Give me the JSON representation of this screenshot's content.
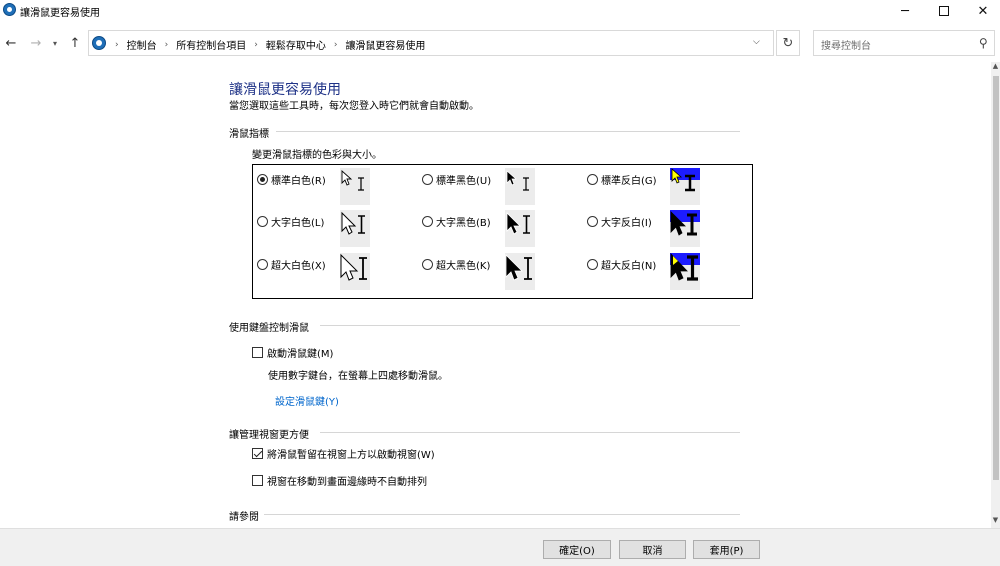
{
  "window": {
    "title": "讓滑鼠更容易使用",
    "minimize_glyph": "─",
    "close_glyph": "✕"
  },
  "nav": {
    "back_glyph": "←",
    "forward_glyph": "→",
    "recent_glyph": "▾",
    "up_glyph": "↑",
    "breadcrumbs": [
      "控制台",
      "所有控制台項目",
      "輕鬆存取中心",
      "讓滑鼠更容易使用"
    ],
    "breadcrumb_sep": "›",
    "dropdown_glyph": "⌵",
    "refresh_glyph": "↻"
  },
  "search": {
    "placeholder": "搜尋控制台",
    "icon_glyph": "⚲"
  },
  "page": {
    "heading": "讓滑鼠更容易使用",
    "subtitle": "當您選取這些工具時，每次您登入時它們就會自動啟動。"
  },
  "pointers": {
    "section_title": "滑鼠指標",
    "instruction": "變更滑鼠指標的色彩與大小。",
    "options": [
      {
        "label": "標準白色(R)",
        "selected": true,
        "scheme": "white",
        "size": "regular"
      },
      {
        "label": "標準黑色(U)",
        "selected": false,
        "scheme": "black",
        "size": "regular"
      },
      {
        "label": "標準反白(G)",
        "selected": false,
        "scheme": "inverted",
        "size": "regular"
      },
      {
        "label": "大字白色(L)",
        "selected": false,
        "scheme": "white",
        "size": "large"
      },
      {
        "label": "大字黑色(B)",
        "selected": false,
        "scheme": "black",
        "size": "large"
      },
      {
        "label": "大字反白(I)",
        "selected": false,
        "scheme": "inverted",
        "size": "large"
      },
      {
        "label": "超大白色(X)",
        "selected": false,
        "scheme": "white",
        "size": "extra-large"
      },
      {
        "label": "超大黑色(K)",
        "selected": false,
        "scheme": "black",
        "size": "extra-large"
      },
      {
        "label": "超大反白(N)",
        "selected": false,
        "scheme": "inverted",
        "size": "extra-large"
      }
    ]
  },
  "mouse_keys": {
    "section_title": "使用鍵盤控制滑鼠",
    "checkbox_label": "啟動滑鼠鍵(M)",
    "checked": false,
    "description": "使用數字鍵台，在螢幕上四處移動滑鼠。",
    "link": "設定滑鼠鍵(Y)"
  },
  "window_management": {
    "section_title": "讓管理視窗更方便",
    "options": [
      {
        "label": "將滑鼠暫留在視窗上方以啟動視窗(W)",
        "checked": true
      },
      {
        "label": "視窗在移動到畫面邊緣時不自動排列",
        "checked": false
      }
    ]
  },
  "see_also": {
    "section_title": "請參閱"
  },
  "scrollbar": {
    "up_glyph": "▲",
    "down_glyph": "▼"
  },
  "footer": {
    "ok": "確定(O)",
    "cancel": "取消",
    "apply": "套用(P)"
  },
  "colors": {
    "heading": "#1e3287",
    "link": "#0066cc",
    "inverted_highlight": "#1c1cff",
    "inverted_arrow": "#ffff00"
  }
}
